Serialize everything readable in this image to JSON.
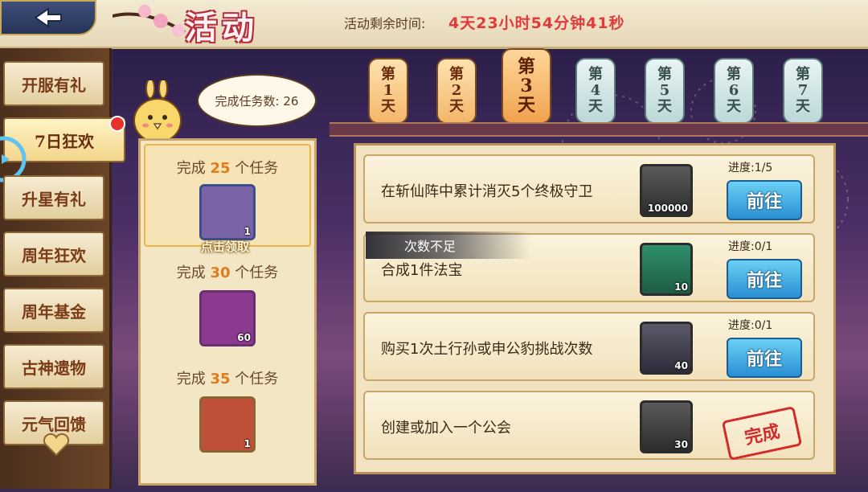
{
  "header": {
    "title": "活动",
    "timer_label": "活动剩余时间:",
    "timer_value": "4天23小时54分钟41秒"
  },
  "sidebar": {
    "items": [
      {
        "label": "开服有礼",
        "active": false
      },
      {
        "label": "7日狂欢",
        "active": true,
        "badge": true
      },
      {
        "label": "升星有礼",
        "active": false
      },
      {
        "label": "周年狂欢",
        "active": false
      },
      {
        "label": "周年基金",
        "active": false
      },
      {
        "label": "古神遗物",
        "active": false
      },
      {
        "label": "元气回馈",
        "active": false
      }
    ]
  },
  "days": [
    {
      "top": "第",
      "num": "1",
      "bottom": "天",
      "state": "past"
    },
    {
      "top": "第",
      "num": "2",
      "bottom": "天",
      "state": "past"
    },
    {
      "top": "第",
      "num": "3",
      "bottom": "天",
      "state": "current"
    },
    {
      "top": "第",
      "num": "4",
      "bottom": "天",
      "state": "future"
    },
    {
      "top": "第",
      "num": "5",
      "bottom": "天",
      "state": "future"
    },
    {
      "top": "第",
      "num": "6",
      "bottom": "天",
      "state": "future"
    },
    {
      "top": "第",
      "num": "7",
      "bottom": "天",
      "state": "future"
    }
  ],
  "mascot": {
    "bubble_text": "完成任务数: 26"
  },
  "rewards": [
    {
      "prefix": "完成",
      "count": "25",
      "suffix": "个任务",
      "icon": "treasure-chest-icon",
      "qty": "1",
      "claim": "点击领取",
      "color": "#7b63a8"
    },
    {
      "prefix": "完成",
      "count": "30",
      "suffix": "个任务",
      "icon": "character-portrait-icon",
      "qty": "60",
      "color": "#8a3a8f"
    },
    {
      "prefix": "完成",
      "count": "35",
      "suffix": "个任务",
      "icon": "dragon-box-icon",
      "qty": "1",
      "color": "#c0503a"
    }
  ],
  "tasks": [
    {
      "text": "在斩仙阵中累计消灭5个终极守卫",
      "progress": "进度:1/5",
      "icon": "gold-coins-icon",
      "qty": "100000",
      "action": "前往",
      "status": "go"
    },
    {
      "text": "合成1件法宝",
      "progress": "进度:0/1",
      "icon": "peach-icon",
      "qty": "10",
      "action": "前往",
      "status": "go"
    },
    {
      "text": "购买1次土行孙或申公豹挑战次数",
      "progress": "进度:0/1",
      "icon": "character-fragment-icon",
      "qty": "40",
      "action": "前往",
      "status": "go"
    },
    {
      "text": "创建或加入一个公会",
      "progress": "",
      "icon": "bamboo-scroll-icon",
      "qty": "30",
      "action": "完成",
      "status": "done"
    }
  ],
  "toast": "次数不足",
  "colors": {
    "accent_red": "#e23a3a",
    "button_blue": "#2a8fd2",
    "highlight_orange": "#e07b1e"
  }
}
